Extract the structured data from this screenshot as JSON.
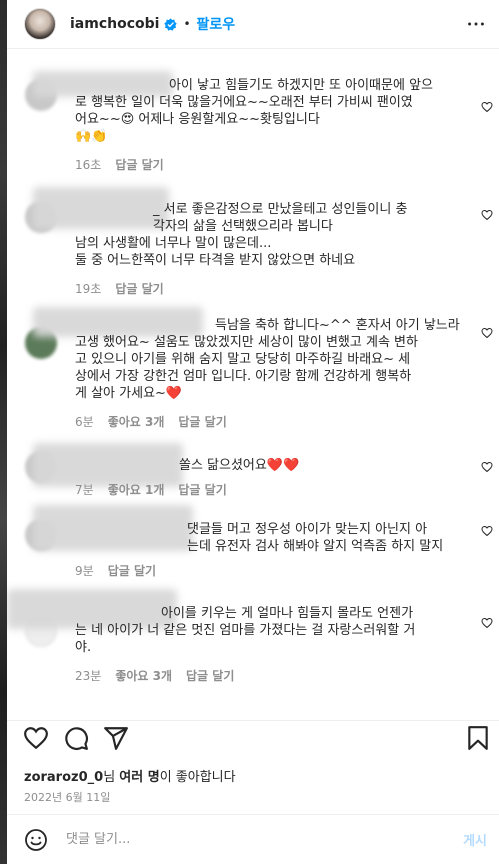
{
  "header": {
    "username": "iamchocobi",
    "separator": "•",
    "follow_label": "팔로우"
  },
  "comments": [
    {
      "lines": [
        "아이 낳고 힘들기도 하겠지만 또 아이때문에 앞으",
        "로 행복한 일이 더욱 많을거에요~~오래전 부터 가비씨 팬이였",
        "어요~~😍 어제나 응원할게요~~홧팅입니다",
        "🙌👏"
      ],
      "time": "16초",
      "reply": "답글 달기",
      "likes": ""
    },
    {
      "lines": [
        "_ 서로 좋은감정으로 만났을테고 성인들이니 충",
        "각자의 삶을 선택했으리라 봅니다",
        "남의 사생활에 너무나 말이 많은데...",
        "둘 중 어느한쪽이 너무 타격을 받지 않았으면 하네요"
      ],
      "time": "19초",
      "reply": "답글 달기",
      "likes": ""
    },
    {
      "lines": [
        "득남을 축하 합니다~^^ 혼자서 아기 낳느라",
        "고생 했어요~ 설움도 많았겠지만 세상이 많이 변했고 계속 변하",
        "고 있으니 아기를 위해 숨지 말고 당당히 마주하길 바래요~ 세",
        "상에서 가장 강한건 엄마 입니다. 아기랑 함께 건강하게 행복하",
        "게 살아 가세요~❤️"
      ],
      "time": "6분",
      "likes": "좋아요 3개",
      "reply": "답글 달기"
    },
    {
      "lines": [
        "쏠스 닮으셨어요❤️❤️"
      ],
      "time": "7분",
      "likes": "좋아요 1개",
      "reply": "답글 달기"
    },
    {
      "lines": [
        "댓글들 머고 정우성 아이가 맞는지 아닌지 아",
        "는데 유전자 검사 해봐야 알지 억측좀 하지 말지"
      ],
      "time": "9분",
      "reply": "답글 달기",
      "likes": ""
    },
    {
      "lines": [
        "아이를 키우는 게 얼마나 힘들지 몰라도 언젠가",
        "는 네 아이가 너 같은 멋진 엄마를 가졌다는 걸 자랑스러워할 거",
        "야."
      ],
      "time": "23분",
      "likes": "좋아요 3개",
      "reply": "답글 달기"
    }
  ],
  "likes_summary": {
    "user": "zoraroz0_0",
    "suffix": "님 ",
    "bold": "여러 명",
    "rest": "이 좋아합니다"
  },
  "post_date": "2022년 6월 11일",
  "comment_box": {
    "placeholder": "댓글 달기...",
    "post_label": "게시"
  },
  "colors": {
    "accent": "#0095f6",
    "heart": "#ed4956",
    "muted": "#8e8e8e",
    "disabled_post": "#b3dbff"
  },
  "icons": [
    "verified-badge-icon",
    "more-options-icon",
    "heart-icon",
    "comment-icon",
    "share-icon",
    "bookmark-icon",
    "emoji-icon"
  ]
}
